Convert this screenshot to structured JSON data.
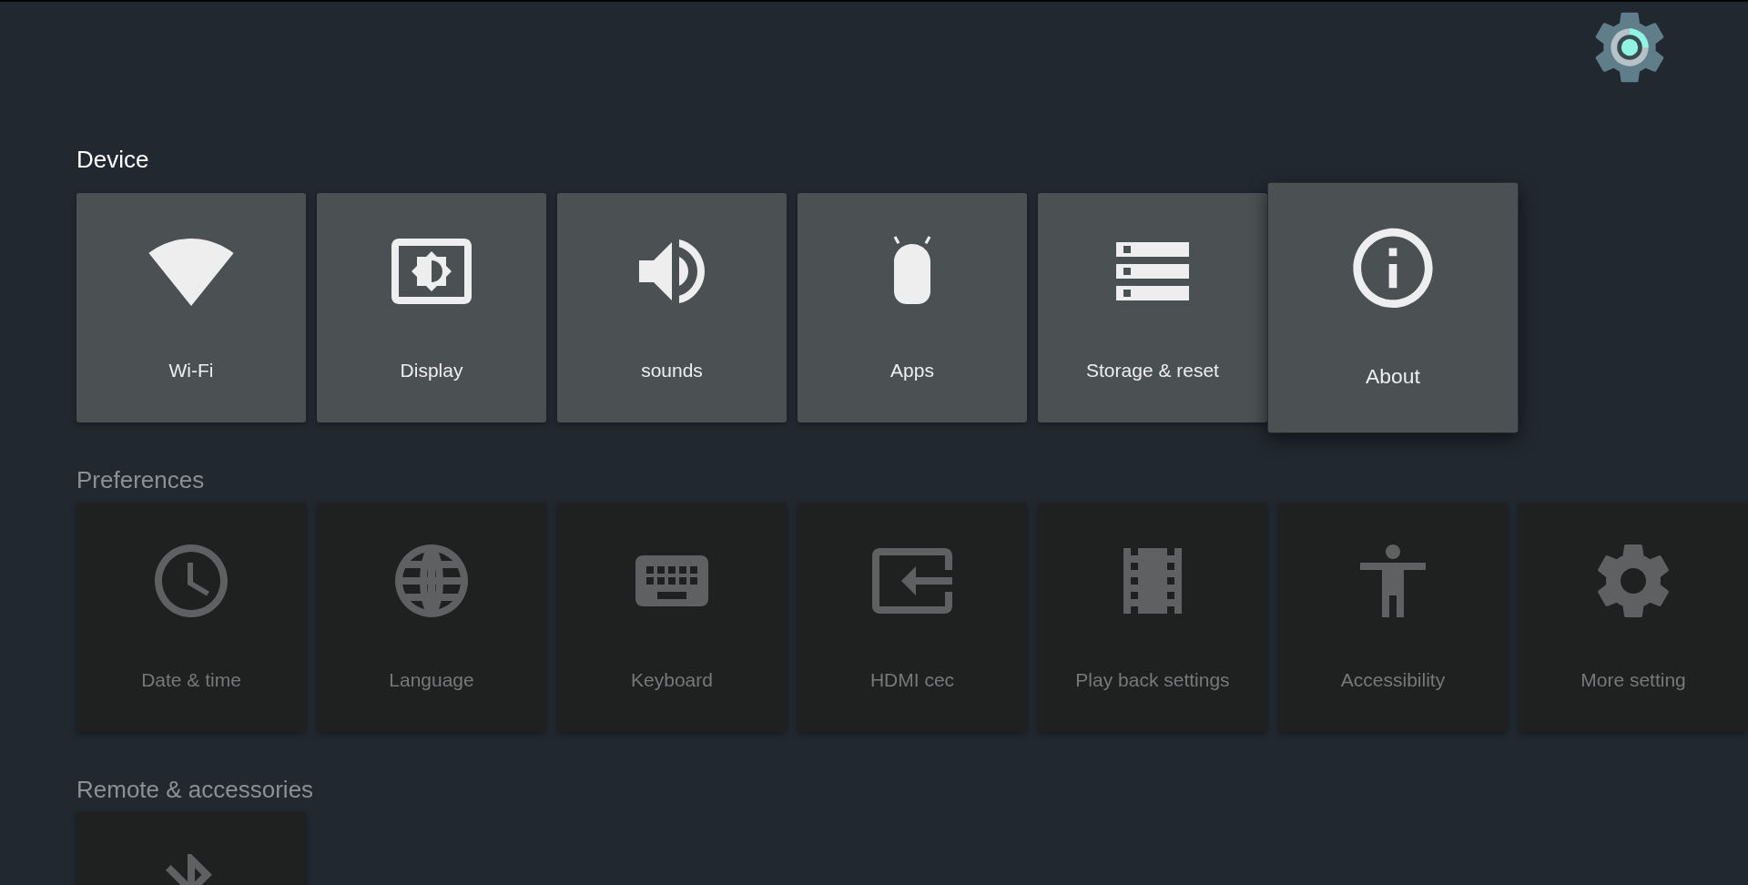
{
  "sections": [
    {
      "title": "Device",
      "selected": true,
      "items": [
        {
          "kind": "wifi",
          "label": "Wi-Fi",
          "selected": false
        },
        {
          "kind": "display",
          "label": "Display",
          "selected": false
        },
        {
          "kind": "sound",
          "label": "sounds",
          "selected": false
        },
        {
          "kind": "apps",
          "label": "Apps",
          "selected": false
        },
        {
          "kind": "storage",
          "label": "Storage & reset",
          "selected": false
        },
        {
          "kind": "about",
          "label": "About",
          "selected": true
        }
      ]
    },
    {
      "title": "Preferences",
      "selected": false,
      "items": [
        {
          "kind": "time",
          "label": "Date & time",
          "selected": false
        },
        {
          "kind": "language",
          "label": "Language",
          "selected": false
        },
        {
          "kind": "keyboard",
          "label": "Keyboard",
          "selected": false
        },
        {
          "kind": "input",
          "label": "HDMI cec",
          "selected": false
        },
        {
          "kind": "film",
          "label": "Play back settings",
          "selected": false
        },
        {
          "kind": "accessibility",
          "label": "Accessibility",
          "selected": false
        },
        {
          "kind": "gear",
          "label": "More setting",
          "selected": false
        }
      ]
    },
    {
      "title": "Remote & accessories",
      "selected": false,
      "items": [
        {
          "kind": "bluetooth",
          "selected": false
        }
      ]
    }
  ]
}
